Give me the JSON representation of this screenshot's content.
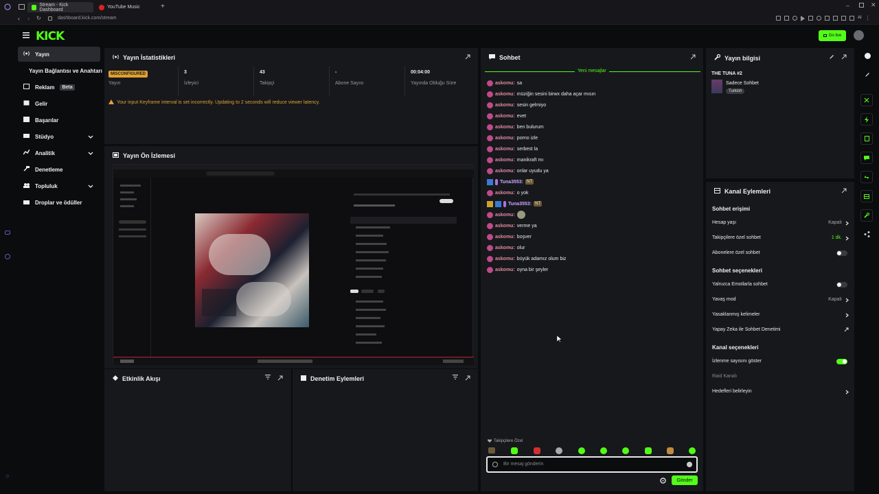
{
  "browser": {
    "tabs": [
      {
        "label": "Stream - Kick Dashboard",
        "active": true
      },
      {
        "label": "YouTube Music",
        "active": false
      }
    ],
    "url": "dashboard.kick.com/stream",
    "extension_text": "AI"
  },
  "header": {
    "logo": "KICK",
    "go_live_label": "Go live"
  },
  "sidebar": {
    "items": [
      {
        "label": "Yayın",
        "icon": "broadcast-icon",
        "active": true,
        "chevron": false
      },
      {
        "label": "Yayın Bağlantısı ve Anahtarı",
        "icon": "",
        "active": false,
        "chevron": false
      },
      {
        "label": "Reklam",
        "icon": "ad-icon",
        "active": false,
        "chevron": false,
        "badge": "Beta"
      },
      {
        "label": "Gelir",
        "icon": "revenue-icon",
        "active": false,
        "chevron": false
      },
      {
        "label": "Başarılar",
        "icon": "trophy-icon",
        "active": false,
        "chevron": false
      },
      {
        "label": "Stüdyo",
        "icon": "studio-icon",
        "active": false,
        "chevron": true
      },
      {
        "label": "Analitik",
        "icon": "analytics-icon",
        "active": false,
        "chevron": true
      },
      {
        "label": "Denetleme",
        "icon": "gavel-icon",
        "active": false,
        "chevron": false
      },
      {
        "label": "Topluluk",
        "icon": "community-icon",
        "active": false,
        "chevron": true
      },
      {
        "label": "Droplar ve ödüller",
        "icon": "drops-icon",
        "active": false,
        "chevron": false
      }
    ]
  },
  "stats_panel": {
    "title": "Yayın İstatistikleri",
    "status_badge": "MISCONFIGURED",
    "status_label": "Yayın",
    "stats": [
      {
        "value": "3",
        "label": "İzleyici"
      },
      {
        "value": "43",
        "label": "Takipçi"
      },
      {
        "value": "-",
        "label": "Abone Sayısı"
      },
      {
        "value": "00:04:00",
        "label": "Yayında Olduğu Süre"
      }
    ],
    "warning": "Your input Keyframe interval is set incorrectly. Updating to 2 seconds will reduce viewer latency."
  },
  "preview_panel": {
    "title": "Yayın Ön İzlemesi"
  },
  "activity_panel": {
    "title": "Etkinlik Akışı"
  },
  "moderation_panel": {
    "title": "Denetim Eylemleri"
  },
  "chat": {
    "title": "Sohbet",
    "new_messages": "Yeni mesajlar",
    "messages": [
      {
        "user": "askomu:",
        "text": "sa"
      },
      {
        "user": "askomu:",
        "text": "müziğin sesini birwx daha açar mısın"
      },
      {
        "user": "askomu:",
        "text": "sesin gelmiyo"
      },
      {
        "user": "askomu:",
        "text": "evet"
      },
      {
        "user": "askomu:",
        "text": "ben bulurum"
      },
      {
        "user": "askomu:",
        "text": "porno izle"
      },
      {
        "user": "askomu:",
        "text": "serbest la"
      },
      {
        "user": "askomu:",
        "text": "manikraft mı"
      },
      {
        "user": "askomu:",
        "text": "onlar uyudu ya"
      },
      {
        "user": "Tuna3553:",
        "text": "",
        "emote": "NT"
      },
      {
        "user": "askomu:",
        "text": "o yok"
      },
      {
        "user": "Tuna3553:",
        "text": "",
        "emote": "NT"
      },
      {
        "user": "askomu:",
        "text": "",
        "emote": "face"
      },
      {
        "user": "askomu:",
        "text": "verme ya"
      },
      {
        "user": "askomu:",
        "text": "boşver"
      },
      {
        "user": "askomu:",
        "text": "olur"
      },
      {
        "user": "askomu:",
        "text": "büyük adamız olum biz"
      },
      {
        "user": "askomu:",
        "text": "oyna bir şeyler"
      }
    ],
    "followers_only_label": "Takipçilere Özel",
    "input_placeholder": "Bir mesaj gönderin",
    "send_label": "Gönder"
  },
  "stream_info": {
    "title": "Yayın bilgisi",
    "stream_title": "THE TUNA #2",
    "category": "Sadece Sohbet",
    "language_tag": "Turkish"
  },
  "channel_actions": {
    "title": "Kanal Eylemleri",
    "sections": {
      "chat_access": "Sohbet erişimi",
      "chat_options": "Sohbet seçenekleri",
      "channel_options": "Kanal seçenekleri"
    },
    "rows": {
      "account_age": {
        "label": "Hesap yaşı",
        "value": "Kapalı"
      },
      "followers_chat": {
        "label": "Takipçilere özel sohbet",
        "value": "1 dk."
      },
      "subscribers_chat": {
        "label": "Abonelere özel sohbet"
      },
      "emotes_only": {
        "label": "Yalnızca Emotlarla sohbet"
      },
      "slow_mode": {
        "label": "Yavaş mod",
        "value": "Kapalı"
      },
      "banned_words": {
        "label": "Yasaklanmış kelimeler"
      },
      "ai_moderation": {
        "label": "Yapay Zeka ile Sohbet Denetimi"
      },
      "show_viewers": {
        "label": "İzlenme sayısını göster"
      },
      "raid_channel": {
        "label": "Raid Kanalı"
      },
      "set_goals": {
        "label": "Hedefleri belirleyin"
      }
    }
  },
  "colors": {
    "accent": "#53fc18",
    "warning": "#e0a030",
    "panel": "#17181c"
  }
}
